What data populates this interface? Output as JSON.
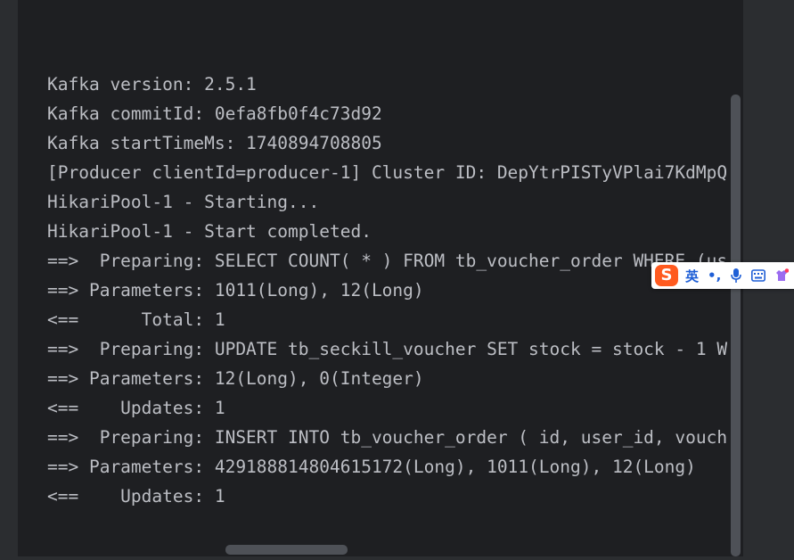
{
  "console": {
    "lines": [
      "Kafka version: 2.5.1",
      "Kafka commitId: 0efa8fb0f4c73d92",
      "Kafka startTimeMs: 1740894708805",
      "[Producer clientId=producer-1] Cluster ID: DepYtrPISTyVPlai7KdMpQ",
      "HikariPool-1 - Starting...",
      "HikariPool-1 - Start completed.",
      "==>  Preparing: SELECT COUNT( * ) FROM tb_voucher_order WHERE (us",
      "==> Parameters: 1011(Long), 12(Long)",
      "<==      Total: 1",
      "==>  Preparing: UPDATE tb_seckill_voucher SET stock = stock - 1 W",
      "==> Parameters: 12(Long), 0(Integer)",
      "<==    Updates: 1",
      "==>  Preparing: INSERT INTO tb_voucher_order ( id, user_id, vouch",
      "==> Parameters: 429188814804615172(Long), 1011(Long), 12(Long)",
      "<==    Updates: 1"
    ]
  },
  "ime_toolbar": {
    "logo": "S",
    "language": "英",
    "punctuation": "•,",
    "icons": [
      "microphone-icon",
      "keyboard-icon",
      "skin-icon"
    ]
  },
  "colors": {
    "console_background": "#1e1f22",
    "panel_background": "#2b2d30",
    "text": "#bcbec4",
    "ime_logo": "#ff5a1f",
    "ime_accent": "#1f5fd6"
  }
}
